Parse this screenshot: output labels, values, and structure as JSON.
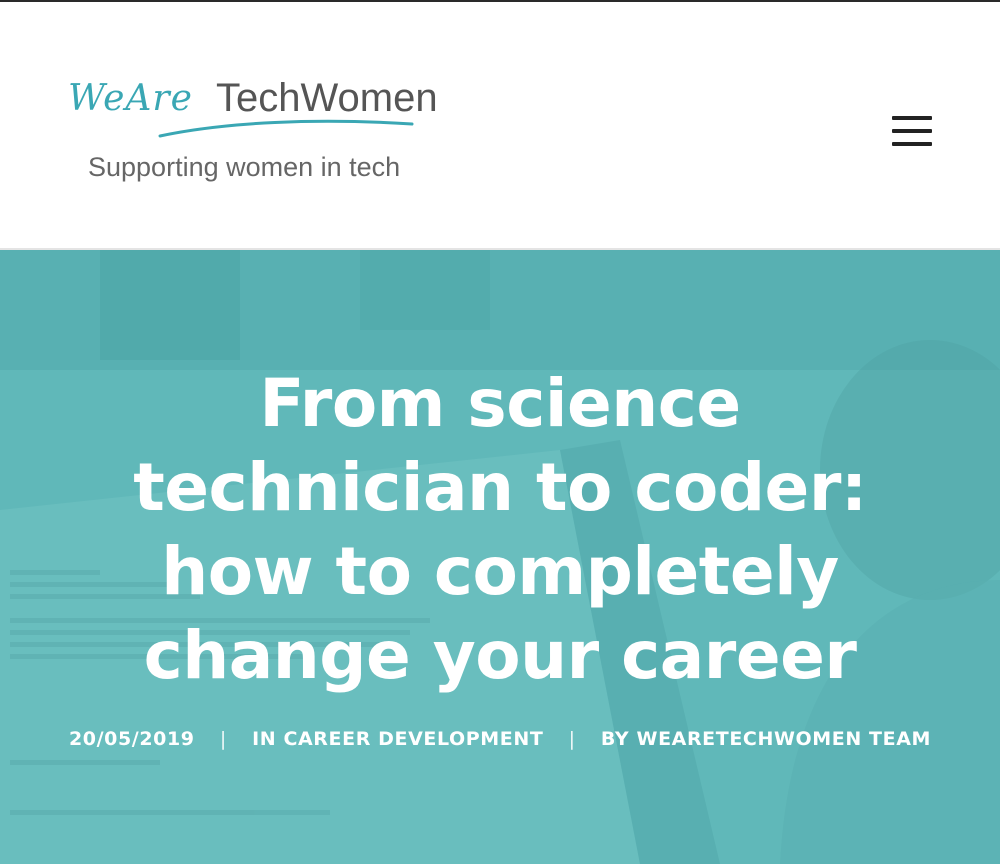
{
  "header": {
    "logo": {
      "script_text": "WeAre",
      "word_text": "TechWomen",
      "tagline": "Supporting women in tech",
      "script_color": "#3aa7b4",
      "swoosh_color": "#3aa7b4"
    },
    "menu_icon": "hamburger-menu-icon"
  },
  "hero": {
    "overlay_color": "#5db8b9",
    "title": "From science technician to coder: how to completely change your career",
    "meta": {
      "date": "20/05/2019",
      "separator": "|",
      "category_prefix": "IN",
      "category": "CAREER DEVELOPMENT",
      "author_prefix": "BY",
      "author": "WEARETECHWOMEN TEAM"
    }
  }
}
